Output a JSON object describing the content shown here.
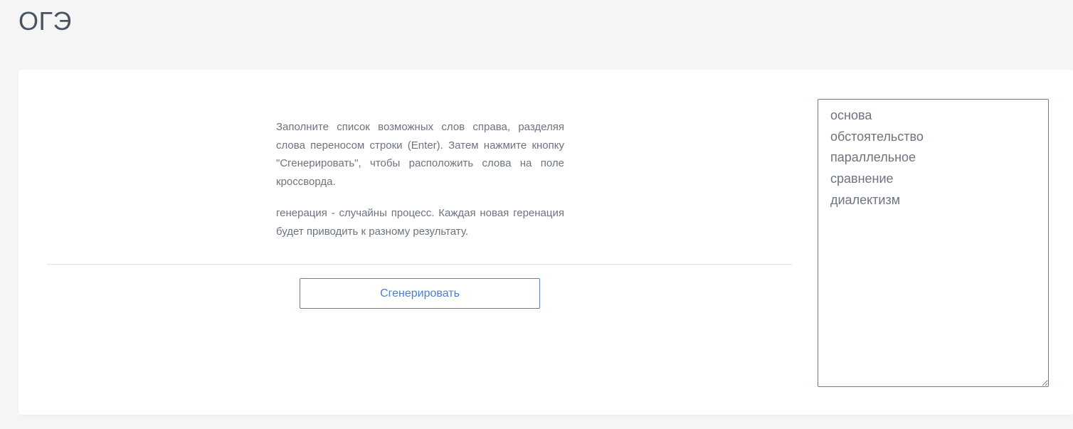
{
  "header": {
    "title": "ОГЭ"
  },
  "instructions": {
    "paragraph1": "Заполните список возможных слов справа, разделяя слова переносом строки (Enter). Затем нажмите кнопку \"Сгенерировать\", чтобы расположить слова на поле кроссворда.",
    "paragraph2": "генерация - случайны процесс. Каждая новая геренация будет приводить к разному результату."
  },
  "actions": {
    "generate_label": "Сгенерировать"
  },
  "words_input": {
    "value": "основа\nобстоятельство\nпараллельное\nсравнение\nдиалектизм"
  },
  "colors": {
    "accent": "#4a7fcf",
    "textarea_border": "#3d8fa8",
    "text": "#6c7480",
    "background": "#f5f5f5"
  }
}
